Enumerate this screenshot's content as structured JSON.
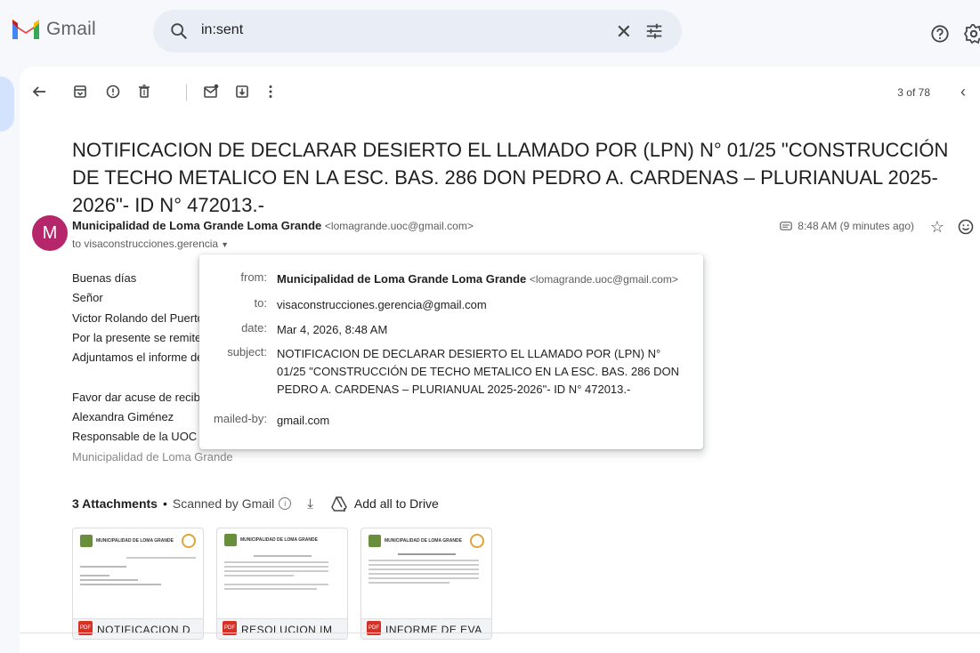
{
  "app": {
    "name": "Gmail"
  },
  "search": {
    "value": "in:sent"
  },
  "toolbar": {
    "pager": "3 of 78"
  },
  "email": {
    "subject": "NOTIFICACION DE DECLARAR DESIERTO EL LLAMADO POR (LPN) N° 01/25 \"CONSTRUCCIÓN DE TECHO METALICO EN LA ESC. BAS. 286 DON PEDRO A. CARDENAS – PLURIANUAL 2025-2026\"- ID N° 472013.-",
    "avatar_letter": "M",
    "sender_name": "Municipalidad de Loma Grande Loma Grande",
    "sender_email": "<lomagrande.uoc@gmail.com>",
    "to_line": "to visaconstrucciones.gerencia",
    "time": "8:48 AM (9 minutes ago)",
    "body": {
      "l1": "Buenas días",
      "l2": "Señor",
      "l3": "Victor Rolando del Puerto",
      "l4": "Por la presente se remite la no",
      "l5": "Adjuntamos el informe de eva",
      "l6": "Favor dar acuse de recibido",
      "l7": "Alexandra Giménez",
      "l8": "Responsable de la UOC",
      "l9": "Municipalidad de Loma Grande"
    }
  },
  "details_popup": {
    "from_label": "from:",
    "from_name": "Municipalidad de Loma Grande Loma Grande",
    "from_email": "<lomagrande.uoc@gmail.com>",
    "to_label": "to:",
    "to_value": "visaconstrucciones.gerencia@gmail.com",
    "date_label": "date:",
    "date_value": "Mar 4, 2026, 8:48 AM",
    "subject_label": "subject:",
    "subject_value": "NOTIFICACION DE DECLARAR DESIERTO EL LLAMADO POR (LPN) N° 01/25 \"CONSTRUCCIÓN DE TECHO METALICO EN LA ESC. BAS. 286 DON PEDRO A. CARDENAS – PLURIANUAL 2025-2026\"- ID N° 472013.-",
    "mailedby_label": "mailed-by:",
    "mailedby_value": "gmail.com"
  },
  "attachments": {
    "count_label": "3 Attachments",
    "dot": "•",
    "scanned_label": "Scanned by Gmail",
    "add_all_label": "Add all to Drive",
    "items": [
      {
        "name": "NOTIFICACION D",
        "badge": "PDF",
        "header": "MUNICIPALIDAD DE LOMA GRANDE"
      },
      {
        "name": "RESOLUCION IM",
        "badge": "PDF",
        "header": "MUNICIPALIDAD DE LOMA GRANDE"
      },
      {
        "name": "INFORME DE EVA",
        "badge": "PDF",
        "header": "MUNICIPALIDAD DE LOMA GRANDE"
      }
    ]
  },
  "colors": {
    "avatar_bg": "#b5266b",
    "accent": "#d3e3fd",
    "pdf_red": "#d93025"
  },
  "icons": [
    "gmail-logo-icon",
    "search-icon",
    "clear-icon",
    "tune-icon",
    "help-icon",
    "settings-icon",
    "back-icon",
    "archive-icon",
    "report-spam-icon",
    "delete-icon",
    "mark-unread-icon",
    "move-to-icon",
    "more-icon",
    "chevron-left-icon",
    "label-icon",
    "star-icon",
    "emoji-icon",
    "download-icon",
    "drive-icon"
  ]
}
